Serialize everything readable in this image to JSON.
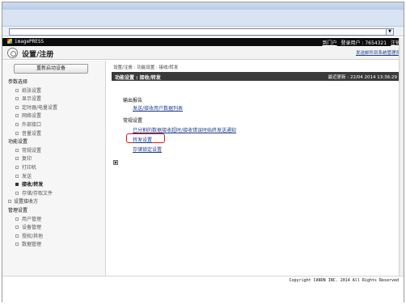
{
  "browser": {
    "address_dropdown_glyph": "▼"
  },
  "topbar": {
    "brand": "imagePRESS",
    "portal_link": "到门户",
    "login_label": "登录用户 : 7654321",
    "logout_link": "注销"
  },
  "header": {
    "title": "设置/注册",
    "admin_mail_link": "发送邮件到系统管理员",
    "icon": "gear-icon"
  },
  "sidebar": {
    "restart_button": "重新启动设备",
    "menu": [
      {
        "label": "参数选择",
        "type": "group"
      },
      {
        "label": "纸张设置",
        "type": "item"
      },
      {
        "label": "显示设置",
        "type": "item"
      },
      {
        "label": "定时器/电量设置",
        "type": "item"
      },
      {
        "label": "网络设置",
        "type": "item"
      },
      {
        "label": "外部接口",
        "type": "item"
      },
      {
        "label": "音量设置",
        "type": "item"
      },
      {
        "label": "功能设置",
        "type": "group"
      },
      {
        "label": "常规设置",
        "type": "item"
      },
      {
        "label": "复印",
        "type": "item"
      },
      {
        "label": "打印机",
        "type": "item"
      },
      {
        "label": "发送",
        "type": "item"
      },
      {
        "label": "接收/转发",
        "type": "item",
        "active": true
      },
      {
        "label": "存储/存取文件",
        "type": "item"
      },
      {
        "label": "设置接收方",
        "type": "subgroup"
      },
      {
        "label": "管理设置",
        "type": "group"
      },
      {
        "label": "用户管理",
        "type": "item"
      },
      {
        "label": "设备管理",
        "type": "item"
      },
      {
        "label": "授权/其他",
        "type": "item"
      },
      {
        "label": "数据管理",
        "type": "item"
      }
    ]
  },
  "main": {
    "breadcrumb": "设置/注册 : 功能设置 : 接收/转发",
    "panel_title": "功能设置 : 接收/转发",
    "last_updated": "最近更新 : 22/04 2014 13:36:29",
    "sections": {
      "output_report": "输出报告",
      "send_receive_list": "发送/接收用户数据列表",
      "common_settings": "常规设置",
      "notify_link": "已分割的数据接收超时/接收错误时始终发送通知",
      "forward_settings": "转发设置",
      "memory_lock": "存储锁定设置"
    },
    "mini_box_glyph": "▣"
  },
  "footer": {
    "copyright": "Copyright CANON INC. 2014 All Rights Reserved"
  }
}
